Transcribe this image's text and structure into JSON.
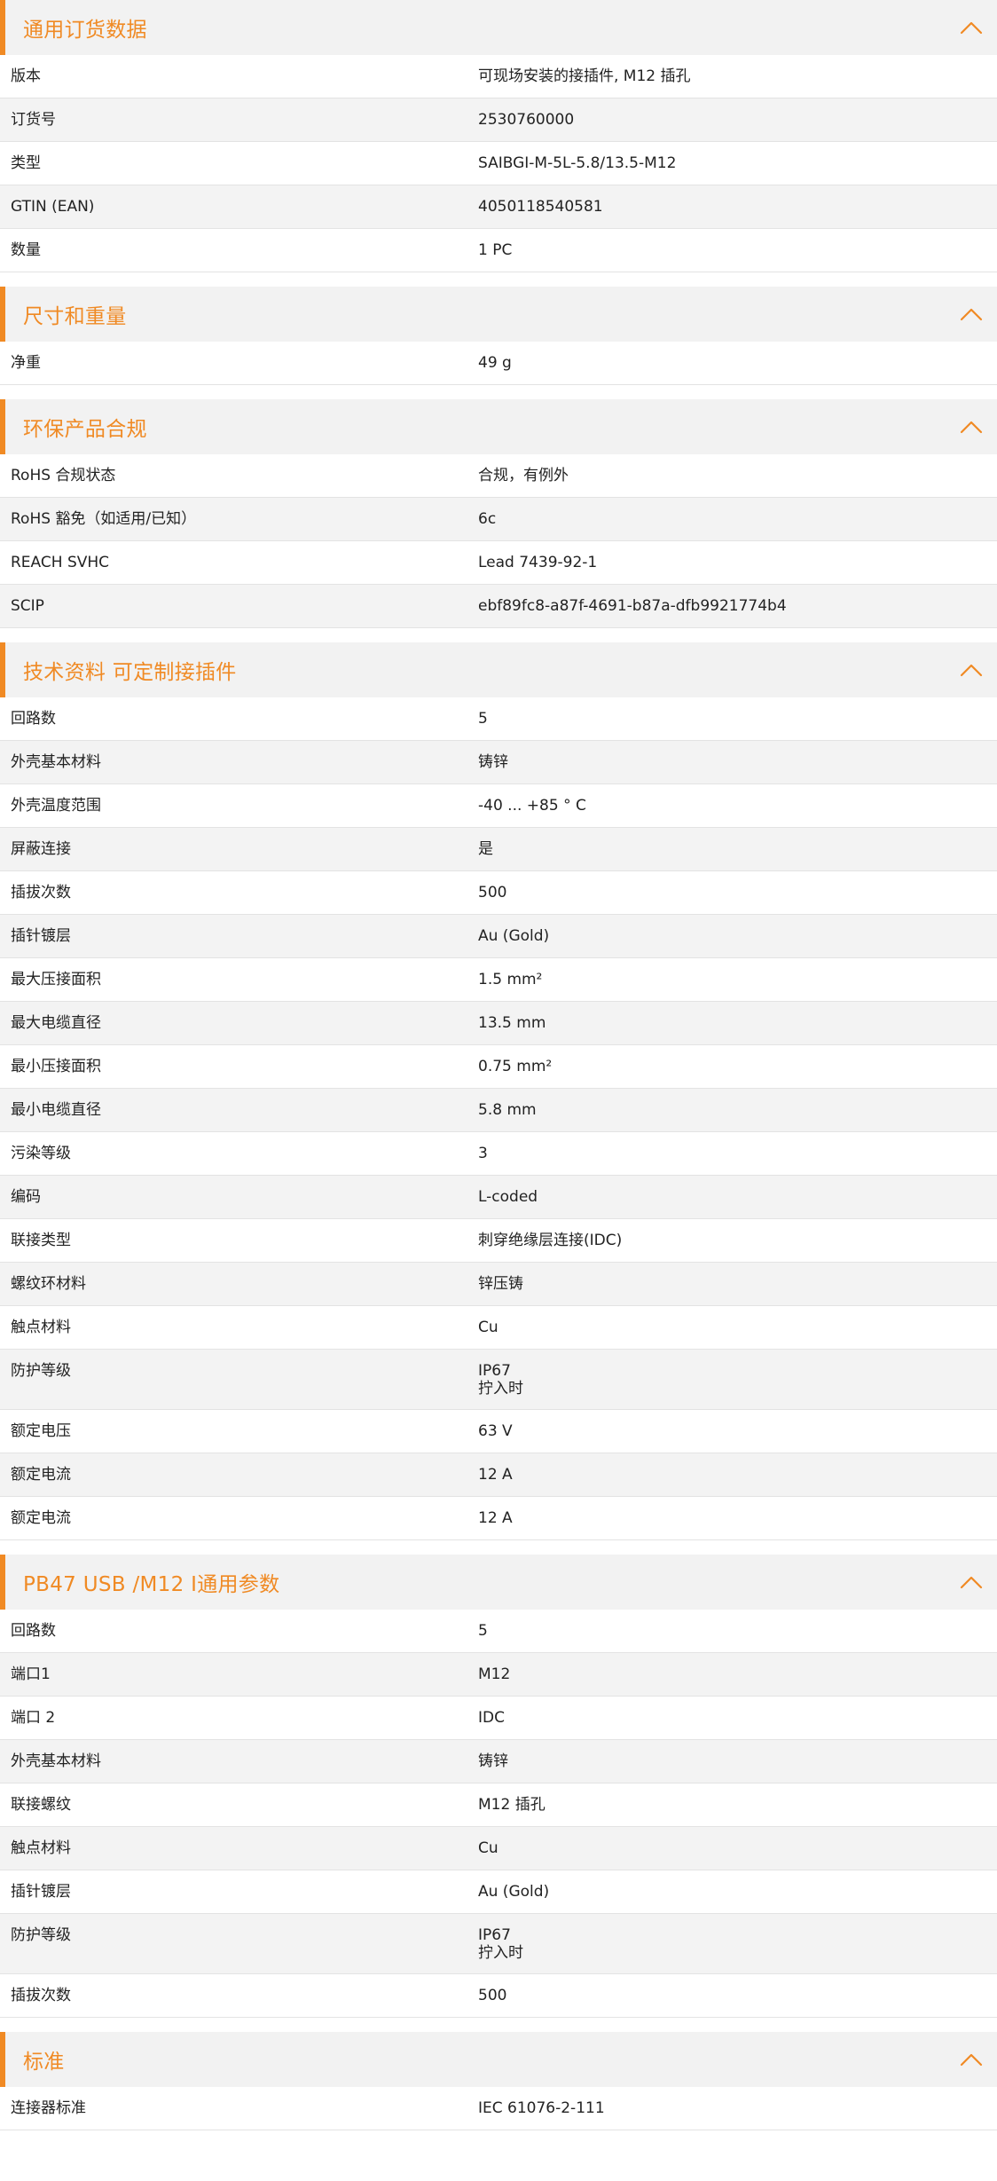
{
  "colors": {
    "accent": "#f08a24",
    "header_bg": "#f2f2f2",
    "stripe": "#f3f3f3"
  },
  "sections": [
    {
      "title": "通用订货数据",
      "rows": [
        {
          "label": "版本",
          "value": "可现场安装的接插件, M12 插孔"
        },
        {
          "label": "订货号",
          "value": "2530760000"
        },
        {
          "label": "类型",
          "value": "SAIBGI-M-5L-5.8/13.5-M12"
        },
        {
          "label": "GTIN (EAN)",
          "value": "4050118540581"
        },
        {
          "label": "数量",
          "value": "1  PC"
        }
      ]
    },
    {
      "title": "尺寸和重量",
      "rows": [
        {
          "label": "净重",
          "value": "49  g"
        }
      ]
    },
    {
      "title": "环保产品合规",
      "rows": [
        {
          "label": "RoHS 合规状态",
          "value": "合规，有例外"
        },
        {
          "label": "RoHS 豁免（如适用/已知）",
          "value": "6c"
        },
        {
          "label": "REACH SVHC",
          "value": "Lead 7439-92-1"
        },
        {
          "label": "SCIP",
          "value": "ebf89fc8-a87f-4691-b87a-dfb9921774b4"
        }
      ]
    },
    {
      "title": "技术资料 可定制接插件",
      "rows": [
        {
          "label": "回路数",
          "value": "5"
        },
        {
          "label": "外壳基本材料",
          "value": "铸锌"
        },
        {
          "label": "外壳温度范围",
          "value": "-40 ... +85 ° C"
        },
        {
          "label": "屏蔽连接",
          "value": "是"
        },
        {
          "label": "插拔次数",
          "value": "500"
        },
        {
          "label": "插针镀层",
          "value": "Au (Gold)"
        },
        {
          "label": "最大压接面积",
          "value": "1.5  mm²"
        },
        {
          "label": "最大电缆直径",
          "value": "13.5  mm"
        },
        {
          "label": "最小压接面积",
          "value": "0.75  mm²"
        },
        {
          "label": "最小电缆直径",
          "value": "5.8  mm"
        },
        {
          "label": "污染等级",
          "value": "3"
        },
        {
          "label": "编码",
          "value": "L-coded"
        },
        {
          "label": "联接类型",
          "value": "刺穿绝缘层连接(IDC)"
        },
        {
          "label": "螺纹环材料",
          "value": "锌压铸"
        },
        {
          "label": "触点材料",
          "value": "Cu"
        },
        {
          "label": "防护等级",
          "value": "IP67",
          "value2": "拧入时"
        },
        {
          "label": "额定电压",
          "value": "63  V"
        },
        {
          "label": "额定电流",
          "value": "12  A"
        },
        {
          "label": "额定电流",
          "value": "12 A"
        }
      ]
    },
    {
      "title": "PB47 USB /M12 I通用参数",
      "rows": [
        {
          "label": "回路数",
          "value": "5"
        },
        {
          "label": "端口1",
          "value": "M12"
        },
        {
          "label": "端口 2",
          "value": "IDC"
        },
        {
          "label": "外壳基本材料",
          "value": "铸锌"
        },
        {
          "label": "联接螺纹",
          "value": "M12 插孔"
        },
        {
          "label": "触点材料",
          "value": "Cu"
        },
        {
          "label": "插针镀层",
          "value": "Au (Gold)"
        },
        {
          "label": "防护等级",
          "value": "IP67",
          "value2": "拧入时"
        },
        {
          "label": "插拔次数",
          "value": "500"
        }
      ]
    },
    {
      "title": "标准",
      "rows": [
        {
          "label": "连接器标准",
          "value": "IEC 61076-2-111"
        }
      ]
    }
  ]
}
